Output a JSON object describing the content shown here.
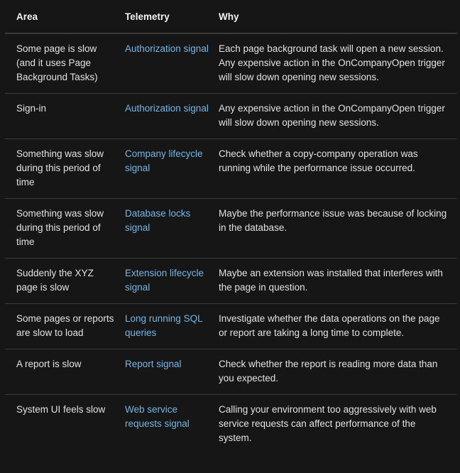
{
  "table": {
    "headers": {
      "area": "Area",
      "telemetry": "Telemetry",
      "why": "Why"
    },
    "link_color": "#75b6e7",
    "rows": [
      {
        "area": "Some page is slow (and it uses Page Background Tasks)",
        "telemetry": "Authorization signal",
        "why": "Each page background task will open a new session. Any expensive action in the OnCompanyOpen trigger will slow down opening new sessions."
      },
      {
        "area": "Sign-in",
        "telemetry": "Authorization signal",
        "why": "Any expensive action in the OnCompanyOpen trigger will slow down opening new sessions."
      },
      {
        "area": "Something was slow during this period of time",
        "telemetry": "Company lifecycle signal",
        "why": "Check whether a copy-company operation was running while the performance issue occurred."
      },
      {
        "area": "Something was slow during this period of time",
        "telemetry": "Database locks signal",
        "why": "Maybe the performance issue was because of locking in the database."
      },
      {
        "area": "Suddenly the XYZ page is slow",
        "telemetry": "Extension lifecycle signal",
        "why": "Maybe an extension was installed that interferes with the page in question."
      },
      {
        "area": "Some pages or reports are slow to load",
        "telemetry": "Long running SQL queries",
        "why": "Investigate whether the data operations on the page or report are taking a long time to complete."
      },
      {
        "area": "A report is slow",
        "telemetry": "Report signal",
        "why": "Check whether the report is reading more data than you expected."
      },
      {
        "area": "System UI feels slow",
        "telemetry": "Web service requests signal",
        "why": "Calling your environment too aggressively with web service requests can affect performance of the system."
      }
    ]
  }
}
